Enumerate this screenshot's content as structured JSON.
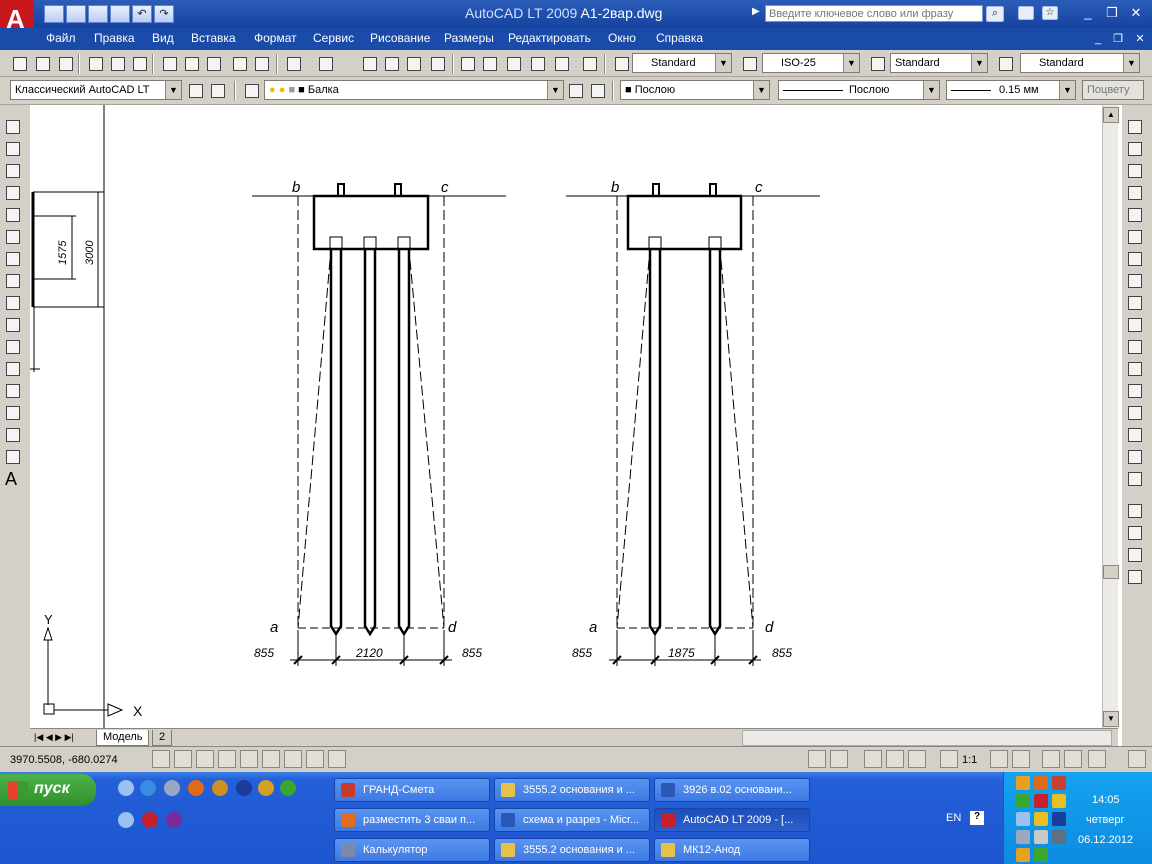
{
  "titlebar": {
    "app": "AutoCAD LT 2009",
    "file": "A1-2вар.dwg",
    "search_placeholder": "Введите ключевое слово или фразу"
  },
  "menu": [
    "Файл",
    "Правка",
    "Вид",
    "Вставка",
    "Формат",
    "Сервис",
    "Рисование",
    "Размеры",
    "Редактировать",
    "Окно",
    "Справка"
  ],
  "styles_toolbar": {
    "text_style": "Standard",
    "dim_style": "ISO-25",
    "table_style": "Standard",
    "mleader_style": "Standard"
  },
  "workspace": "Классический AutoCAD LT",
  "layer": "Балка",
  "properties": {
    "color": "Послою",
    "linetype": "Послою",
    "lineweight": "0.15 мм",
    "plotstyle": "Поцвету"
  },
  "drawing": {
    "left_dims": {
      "inner": "1575",
      "outer": "3000"
    },
    "ucs": {
      "x": "X",
      "y": "Y"
    },
    "left_group": {
      "labels": {
        "b": "b",
        "c": "c",
        "a": "a",
        "d": "d"
      },
      "dims": [
        "855",
        "2120",
        "855"
      ]
    },
    "right_group": {
      "labels": {
        "b": "b",
        "c": "c",
        "a": "a",
        "d": "d"
      },
      "dims": [
        "855",
        "1875",
        "855"
      ]
    }
  },
  "tabs": {
    "model": "Модель",
    "layout2": "2"
  },
  "status": {
    "coords": "3970.5508, -680.0274",
    "scale": "1:1"
  },
  "taskbar": {
    "start": "пуск",
    "tasks": [
      {
        "label": "ГРАНД-Смета",
        "color": "#c83a2a"
      },
      {
        "label": "3555.2 основания и ...",
        "color": "#e8c14a"
      },
      {
        "label": "3926 в.02 основани...",
        "color": "#2b57b8"
      },
      {
        "label": "разместить 3 сваи п...",
        "color": "#e36b1c"
      },
      {
        "label": "схема и разрез - Micr...",
        "color": "#2b57b8"
      },
      {
        "label": "AutoCAD LT 2009 - [...",
        "color": "#c8202a"
      },
      {
        "label": "Калькулятор",
        "color": "#7a8aa8"
      },
      {
        "label": "3555.2 основания и ...",
        "color": "#e8c14a"
      },
      {
        "label": "МК12-Анод",
        "color": "#e8c14a"
      }
    ],
    "lang": "EN",
    "time": "14:05",
    "weekday": "четверг",
    "date": "06.12.2012"
  }
}
